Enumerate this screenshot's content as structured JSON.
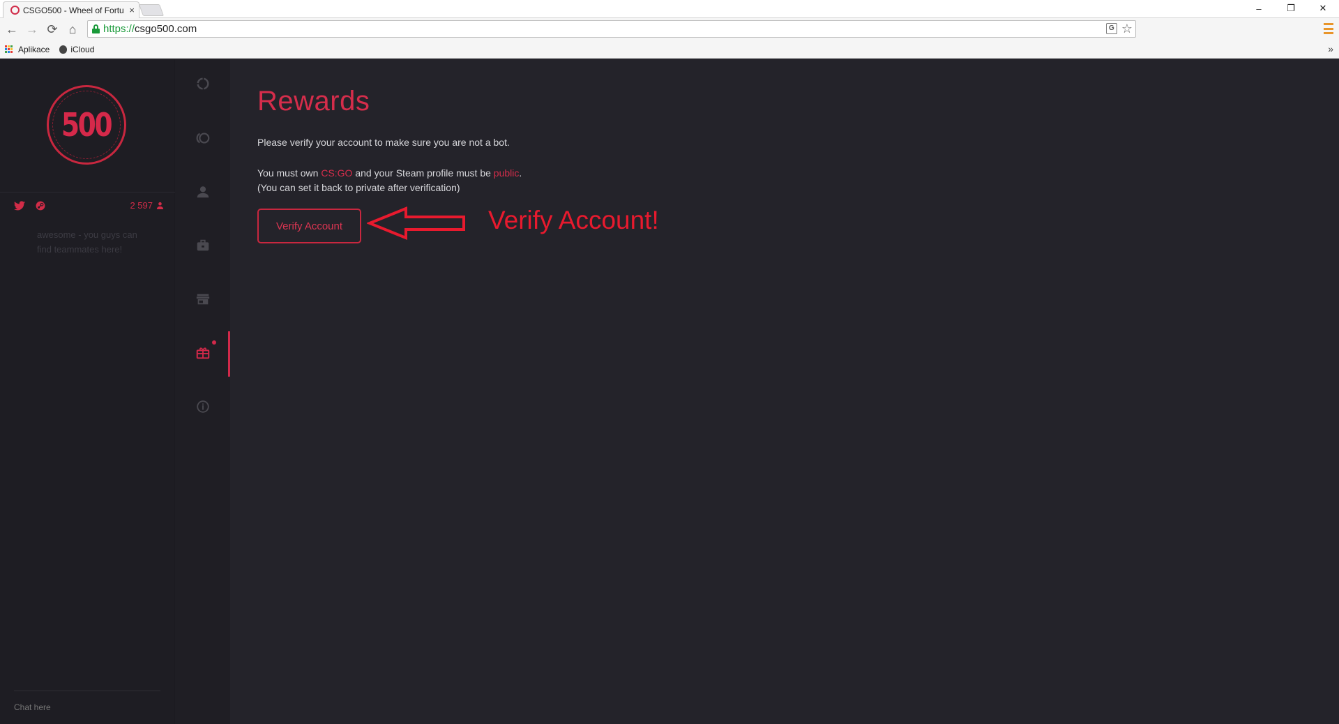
{
  "browser": {
    "tab_title": "CSGO500 - Wheel of Fortu",
    "tab_close": "×",
    "url_scheme": "https://",
    "url_host": "csgo500.com",
    "window_controls": {
      "minimize": "–",
      "restore": "❐",
      "close": "✕"
    },
    "nav": {
      "back": "←",
      "forward": "→",
      "reload": "⟳",
      "home": "⌂"
    },
    "bookmarks": [
      {
        "label": "Aplikace",
        "icon": "apps-grid-icon"
      },
      {
        "label": "iCloud",
        "icon": "apple-icon"
      }
    ],
    "bookmarks_more": "»"
  },
  "sidebar": {
    "logo_text": "500",
    "online_count": "2 597",
    "chat_message": "awesome - you guys can find teammates here!",
    "chat_placeholder": "Chat here"
  },
  "nav_rail": {
    "items": [
      {
        "name": "wheel-icon",
        "active": false
      },
      {
        "name": "coinflip-icon",
        "active": false
      },
      {
        "name": "profile-icon",
        "active": false
      },
      {
        "name": "inventory-icon",
        "active": false
      },
      {
        "name": "shop-icon",
        "active": false
      },
      {
        "name": "rewards-gift-icon",
        "active": true,
        "notification": true
      },
      {
        "name": "info-icon",
        "active": false
      }
    ]
  },
  "rewards": {
    "title": "Rewards",
    "verify_prompt": "Please verify your account to make sure you are not a bot.",
    "req_prefix": "You must own ",
    "req_game": "CS:GO",
    "req_middle": " and your Steam profile must be ",
    "req_public": "public",
    "req_suffix": ".",
    "req_note": "(You can set it back to private after verification)",
    "verify_button": "Verify Account"
  },
  "annotation": {
    "text": "Verify Account!",
    "color": "#e81a2e"
  },
  "colors": {
    "accent": "#d52d4b",
    "page_bg": "#24232a",
    "panel_bg": "#1e1d23"
  }
}
